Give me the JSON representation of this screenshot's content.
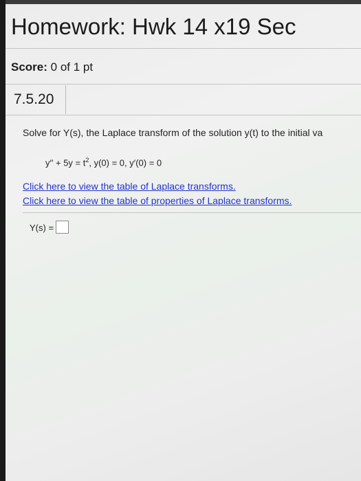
{
  "header": {
    "title": "Homework: Hwk 14 x19 Sec"
  },
  "score": {
    "label": "Score:",
    "value": "0 of 1 pt"
  },
  "question": {
    "number": "7.5.20",
    "prompt": "Solve for Y(s), the Laplace transform of the solution y(t) to the initial va",
    "equation_prefix": "y′′ + 5y = t",
    "equation_exponent": "2",
    "equation_suffix": ", y(0) = 0, y′(0) = 0",
    "links": [
      "Click here to view the table of Laplace transforms.",
      "Click here to view the table of properties of Laplace transforms."
    ],
    "answer_label": "Y(s) ="
  }
}
